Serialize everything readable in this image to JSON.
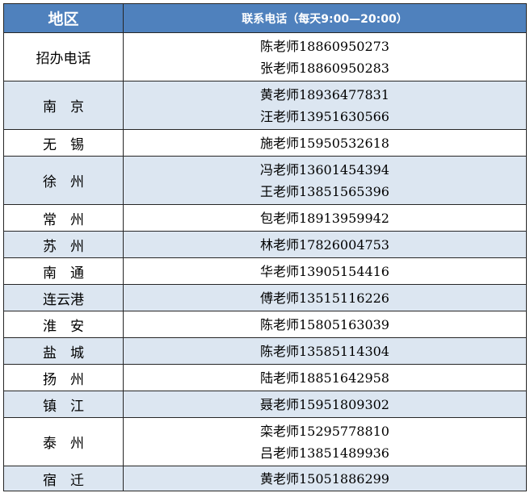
{
  "colors": {
    "header_bg": "#4f81bd",
    "header_text": "#ffffff",
    "alt_row_bg": "#dce6f1",
    "border": "#262626"
  },
  "header": {
    "region": "地区",
    "phone": "联系电话（每天9:00—20:00）"
  },
  "rows": [
    {
      "region": "招办电话",
      "contacts": [
        "陈老师18860950273",
        "张老师18860950283"
      ]
    },
    {
      "region": "南　京",
      "contacts": [
        "黄老师18936477831",
        "汪老师13951630566"
      ]
    },
    {
      "region": "无　锡",
      "contacts": [
        "施老师15950532618"
      ]
    },
    {
      "region": "徐　州",
      "contacts": [
        "冯老师13601454394",
        "王老师13851565396"
      ]
    },
    {
      "region": "常　州",
      "contacts": [
        "包老师18913959942"
      ]
    },
    {
      "region": "苏　州",
      "contacts": [
        "林老师17826004753"
      ]
    },
    {
      "region": "南　通",
      "contacts": [
        "华老师13905154416"
      ]
    },
    {
      "region": "连云港",
      "contacts": [
        "傅老师13515116226"
      ]
    },
    {
      "region": "淮　安",
      "contacts": [
        "陈老师15805163039"
      ]
    },
    {
      "region": "盐　城",
      "contacts": [
        "陈老师13585114304"
      ]
    },
    {
      "region": "扬　州",
      "contacts": [
        "陆老师18851642958"
      ]
    },
    {
      "region": "镇　江",
      "contacts": [
        "聂老师15951809302"
      ]
    },
    {
      "region": "泰　州",
      "contacts": [
        "栾老师15295778810",
        "吕老师13851489936"
      ]
    },
    {
      "region": "宿　迁",
      "contacts": [
        "黄老师15051886299"
      ]
    }
  ]
}
